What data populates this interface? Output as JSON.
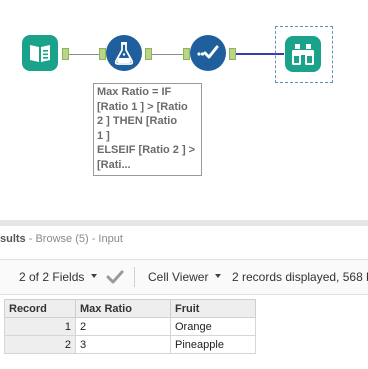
{
  "canvas": {
    "tools": [
      {
        "name": "input-data-tool",
        "icon": "book-icon",
        "color": "#1aa38a"
      },
      {
        "name": "formula-tool",
        "icon": "flask-icon",
        "color": "#1f5f9e"
      },
      {
        "name": "select-tool",
        "icon": "checkmark-icon",
        "color": "#1f5f9e"
      },
      {
        "name": "browse-tool",
        "icon": "binoculars-icon",
        "color": "#1aa38a"
      }
    ],
    "annotation": {
      "lines_bold": [
        "Max Ratio = IF",
        "[Ratio 1 ] > [Ratio",
        "2 ] THEN [Ratio",
        "1 ]"
      ],
      "lines_normal": [
        "ELSEIF [Ratio 2 ] >",
        "[Rati..."
      ]
    }
  },
  "results": {
    "title_bold": "sults",
    "title_rest": " - Browse (5) - Input",
    "toolbar": {
      "fields_label": "2 of 2 Fields",
      "viewer_label": "Cell Viewer",
      "records_info": "2 records displayed, 568 b"
    },
    "table": {
      "headers": [
        "Record",
        "Max Ratio",
        "Fruit"
      ],
      "rows": [
        [
          "1",
          "2",
          "Orange"
        ],
        [
          "2",
          "3",
          "Pineapple"
        ]
      ]
    }
  },
  "colors": {
    "input_tool": "#1aa38a",
    "formula_tool": "#1f5f9e",
    "connection_selected": "#3a3ab8"
  }
}
